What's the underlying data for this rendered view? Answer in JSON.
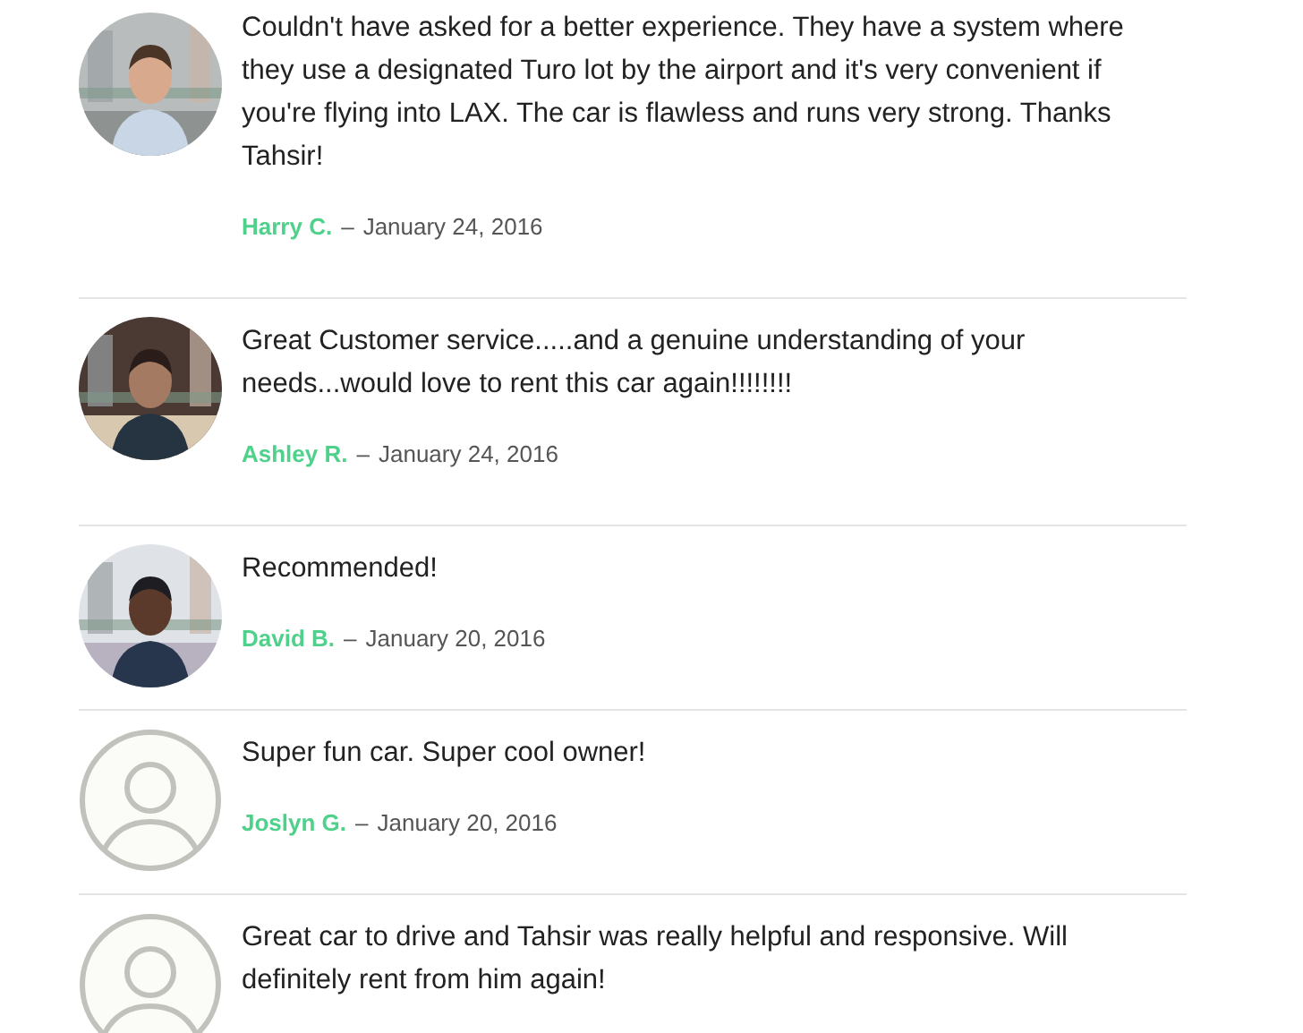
{
  "reviews": [
    {
      "text": "Couldn't have asked for a better experience. They have a system where they use a designated Turo lot by the airport and it's very convenient if you're flying into LAX. The car is flawless and runs very strong. Thanks Tahsir!",
      "author": "Harry C.",
      "separator": "–",
      "date": "January 24, 2016"
    },
    {
      "text": "Great Customer service.....and a genuine understanding of your needs...would love to rent this car again!!!!!!!!",
      "author": "Ashley R.",
      "separator": "–",
      "date": "January 24, 2016"
    },
    {
      "text": "Recommended!",
      "author": "David B.",
      "separator": "–",
      "date": "January 20, 2016"
    },
    {
      "avatar": {
        "kind": "default"
      },
      "text": "Super fun car. Super cool owner!",
      "author": "Joslyn G.",
      "separator": "–",
      "date": "January 20, 2016"
    },
    {
      "avatar": {
        "kind": "default"
      },
      "text": "Great car to drive and Tahsir was really helpful and responsive. Will definitely rent from him again!"
    }
  ]
}
